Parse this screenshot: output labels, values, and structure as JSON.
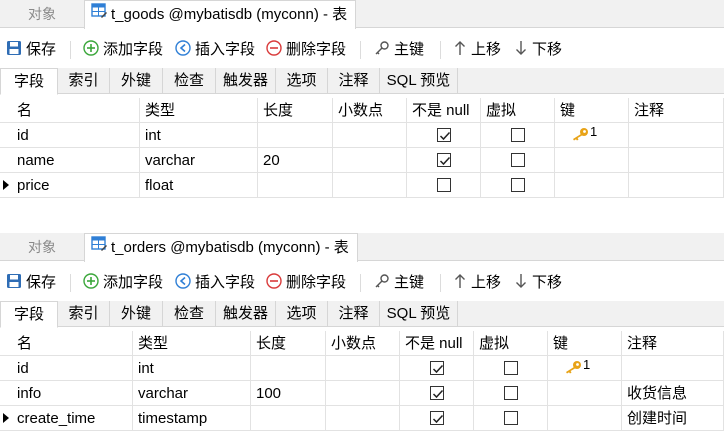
{
  "panels": [
    {
      "object_tab": "对象",
      "doc_tab_title": "t_goods @mybatisdb (myconn) - 表",
      "toolbar": {
        "save": "保存",
        "add_field": "添加字段",
        "insert_field": "插入字段",
        "delete_field": "删除字段",
        "primary_key": "主键",
        "move_up": "上移",
        "move_down": "下移"
      },
      "subtabs": [
        "字段",
        "索引",
        "外键",
        "检查",
        "触发器",
        "选项",
        "注释",
        "SQL 预览"
      ],
      "columns": [
        "名",
        "类型",
        "长度",
        "小数点",
        "不是 null",
        "虚拟",
        "键",
        "注释"
      ],
      "rows": [
        {
          "name": "id",
          "type": "int",
          "length": "",
          "decimals": "",
          "not_null": true,
          "virtual": false,
          "key": "1",
          "comment": "",
          "current": false
        },
        {
          "name": "name",
          "type": "varchar",
          "length": "20",
          "decimals": "",
          "not_null": true,
          "virtual": false,
          "key": "",
          "comment": "",
          "current": false
        },
        {
          "name": "price",
          "type": "float",
          "length": "",
          "decimals": "",
          "not_null": false,
          "virtual": false,
          "key": "",
          "comment": "",
          "current": true
        }
      ]
    },
    {
      "object_tab": "对象",
      "doc_tab_title": "t_orders @mybatisdb (myconn) - 表",
      "toolbar": {
        "save": "保存",
        "add_field": "添加字段",
        "insert_field": "插入字段",
        "delete_field": "删除字段",
        "primary_key": "主键",
        "move_up": "上移",
        "move_down": "下移"
      },
      "subtabs": [
        "字段",
        "索引",
        "外键",
        "检查",
        "触发器",
        "选项",
        "注释",
        "SQL 预览"
      ],
      "columns": [
        "名",
        "类型",
        "长度",
        "小数点",
        "不是 null",
        "虚拟",
        "键",
        "注释"
      ],
      "rows": [
        {
          "name": "id",
          "type": "int",
          "length": "",
          "decimals": "",
          "not_null": true,
          "virtual": false,
          "key": "1",
          "comment": "",
          "current": false
        },
        {
          "name": "info",
          "type": "varchar",
          "length": "100",
          "decimals": "",
          "not_null": true,
          "virtual": false,
          "key": "",
          "comment": "收货信息",
          "current": false
        },
        {
          "name": "create_time",
          "type": "timestamp",
          "length": "",
          "decimals": "",
          "not_null": true,
          "virtual": false,
          "key": "",
          "comment": "创建时间",
          "current": true
        }
      ]
    }
  ],
  "colors": {
    "add_icon": "#3aa63a",
    "insert_icon": "#2f7fd6",
    "delete_icon": "#d93a3a",
    "save_icon": "#2f6db5",
    "key_icon": "#e8a317",
    "table_icon": "#2f7fd6"
  }
}
